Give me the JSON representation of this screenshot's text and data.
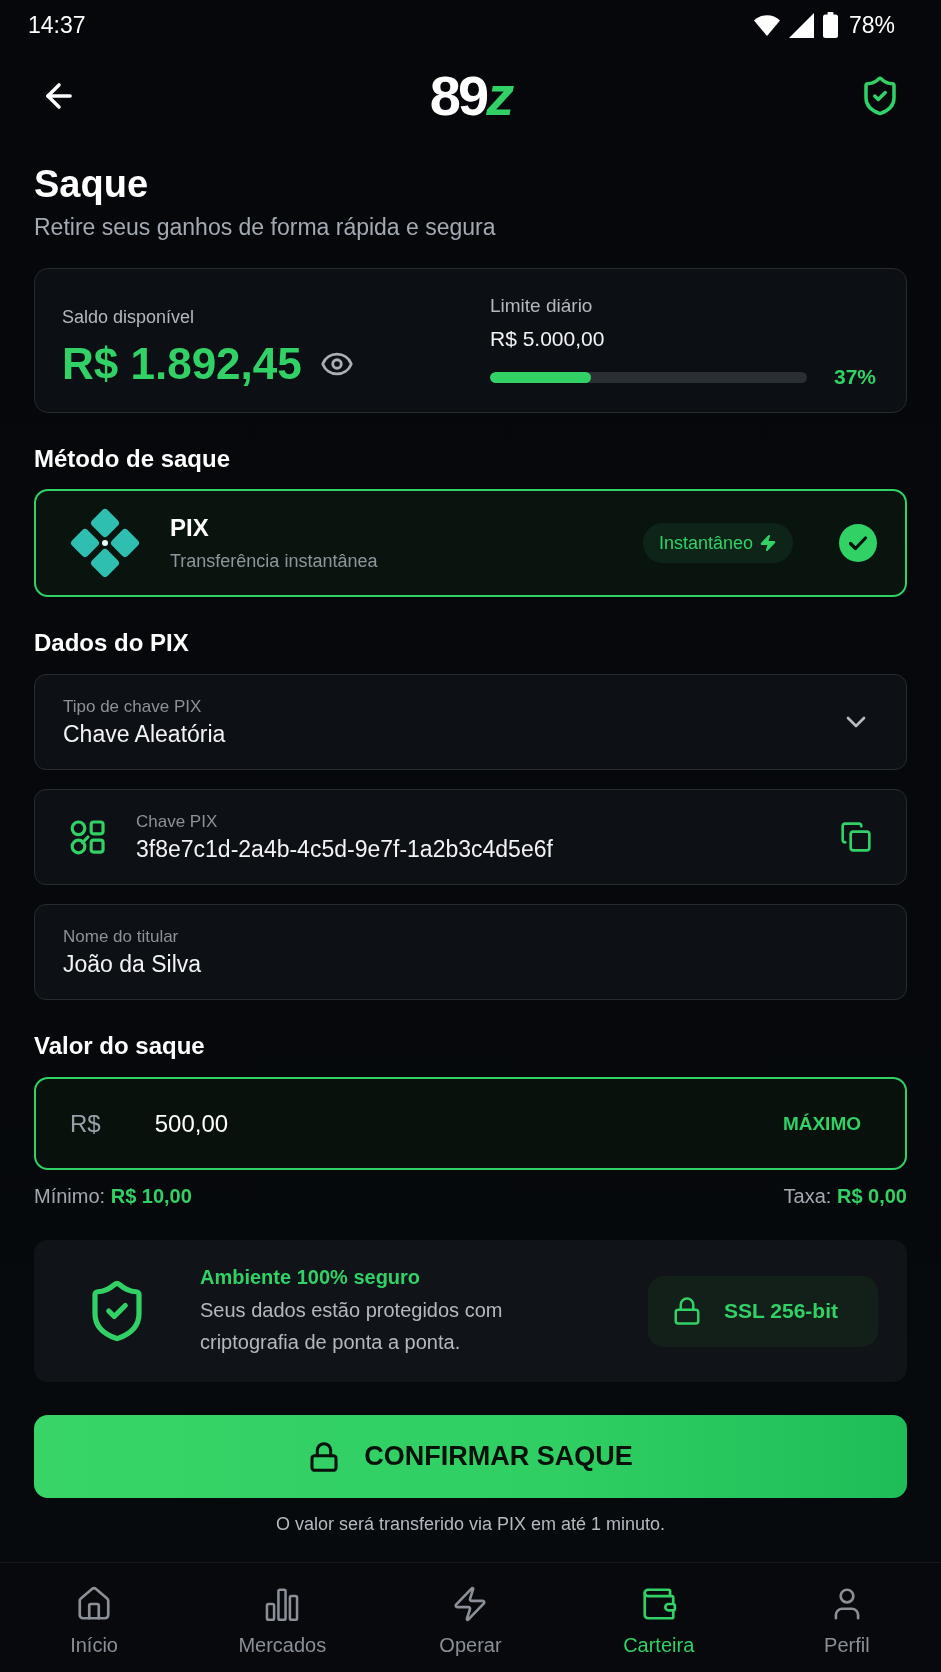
{
  "status_bar": {
    "time": "14:37",
    "battery": "78%"
  },
  "header": {
    "logo": {
      "main": "89",
      "accent": "z"
    }
  },
  "page": {
    "title": "Saque",
    "subtitle": "Retire seus ganhos de forma rápida e segura"
  },
  "balance": {
    "label": "Saldo disponível",
    "amount": "R$ 1.892,45",
    "limit_label": "Limite diário",
    "limit_value": "R$ 5.000,00",
    "limit_usage": {
      "level": 0.32,
      "reading": "37%"
    }
  },
  "method_section": {
    "title": "Método de saque",
    "methods": [
      {
        "name": "PIX",
        "description": "Transferência instantânea",
        "badge": "Instantâneo",
        "selected": true
      }
    ]
  },
  "pix_section": {
    "title": "Dados do PIX",
    "fields": [
      {
        "kind": "select",
        "label": "Tipo de chave PIX",
        "value": "Chave Aleatória"
      },
      {
        "kind": "key",
        "label": "Chave PIX",
        "value": "3f8e7c1d-2a4b-4c5d-9e7f-1a2b3c4d5e6f"
      },
      {
        "kind": "text",
        "label": "Nome do titular",
        "value": "João da Silva"
      }
    ]
  },
  "amount_section": {
    "title": "Valor do saque",
    "focused": true,
    "currency": "R$",
    "value": "500,00",
    "max_label": "MÁXIMO",
    "minimum": {
      "label": "Mínimo:",
      "value": "R$ 10,00"
    },
    "fee": {
      "label": "Taxa:",
      "value": "R$ 0,00"
    }
  },
  "security": {
    "title": "Ambiente 100% seguro",
    "description": "Seus dados estão protegidos com criptografia de ponta a ponta.",
    "badge": "SSL 256-bit"
  },
  "confirm_button": "CONFIRMAR SAQUE",
  "footnote": "O valor será transferido via PIX em até 1 minuto.",
  "bottom_nav": [
    {
      "kind": "home",
      "label": "Início",
      "selected": false
    },
    {
      "kind": "markets",
      "label": "Mercados",
      "selected": false
    },
    {
      "kind": "trade",
      "label": "Operar",
      "selected": false
    },
    {
      "kind": "wallet",
      "label": "Carteira",
      "selected": true
    },
    {
      "kind": "profile",
      "label": "Perfil",
      "selected": false
    }
  ]
}
